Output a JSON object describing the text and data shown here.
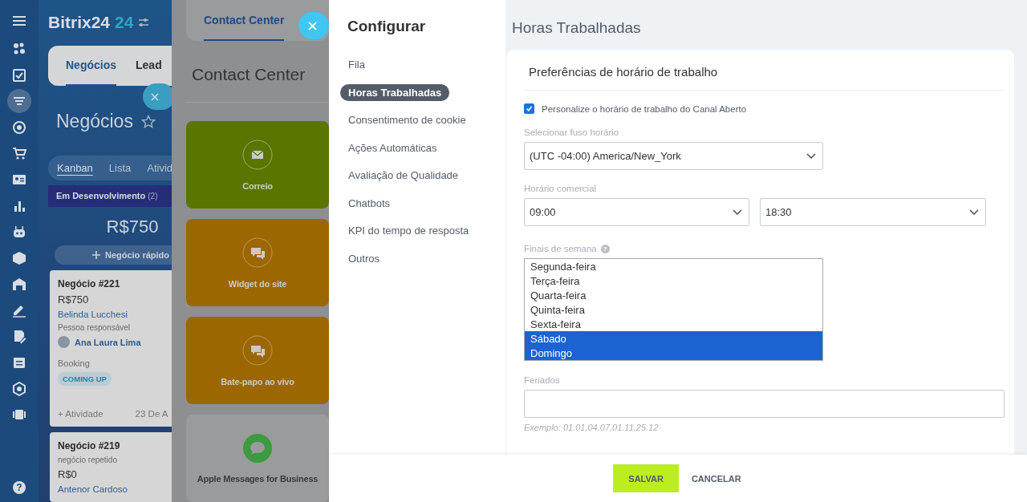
{
  "app": {
    "logo": "Bitrix24",
    "logo_badge": "24",
    "help": "?",
    "nav": [
      {
        "selected": false
      },
      {
        "selected": false
      },
      {
        "selected": true
      },
      {
        "selected": false
      },
      {
        "selected": false
      },
      {
        "selected": false
      },
      {
        "selected": false
      },
      {
        "selected": false
      },
      {
        "selected": false
      },
      {
        "selected": false
      },
      {
        "selected": false
      },
      {
        "selected": false
      },
      {
        "selected": false
      },
      {
        "selected": false
      },
      {
        "selected": false
      }
    ],
    "tabs": [
      {
        "label": "Negócios",
        "selected": true
      },
      {
        "label": "Lead",
        "selected": false
      }
    ],
    "title": "Negócios",
    "views": [
      {
        "label": "Kanban",
        "selected": true
      },
      {
        "label": "Lista",
        "selected": false
      },
      {
        "label": "Ativid",
        "selected": false
      }
    ],
    "column": {
      "title": "Em Desenvolvimento",
      "count": "(2)",
      "total": "R$750",
      "quick_add": "Negócio rápido",
      "cards": [
        {
          "title": "Negócio #221",
          "amount": "R$750",
          "contact": "Belinda Lucchesi",
          "responsible_label": "Pessoa responsável",
          "responsible": "Ana Laura Lima",
          "source": "Booking",
          "tag": "COMING UP",
          "activity": "+ Atividade",
          "date": "23 De A"
        },
        {
          "title": "Negócio #219",
          "note": "negócio repetido",
          "amount": "R$0",
          "contact": "Antenor Cardoso"
        }
      ]
    }
  },
  "contact_center": {
    "tab": "Contact Center",
    "title": "Contact Center",
    "tiles": [
      {
        "label": "Correio",
        "kind": "mail",
        "color": "#5a7500"
      },
      {
        "label": "Widget do site",
        "kind": "chat",
        "color": "#9c6700"
      },
      {
        "label": "Bate-papo ao vivo",
        "kind": "chat",
        "color": "#9c6700"
      },
      {
        "label": "Apple Messages for Business",
        "kind": "bubble",
        "color": "#9a9b9c"
      }
    ]
  },
  "settings": {
    "title": "Configurar",
    "menu": [
      {
        "label": "Fila",
        "selected": false
      },
      {
        "label": "Horas Trabalhadas",
        "selected": true
      },
      {
        "label": "Consentimento de cookie",
        "selected": false
      },
      {
        "label": "Ações Automáticas",
        "selected": false
      },
      {
        "label": "Avaliação de Qualidade",
        "selected": false
      },
      {
        "label": "Chatbots",
        "selected": false
      },
      {
        "label": "KPI do tempo de resposta",
        "selected": false
      },
      {
        "label": "Outros",
        "selected": false
      }
    ],
    "page_title": "Horas Trabalhadas",
    "section_title": "Preferências de horário de trabalho",
    "customize": {
      "label": "Personalize o horário de trabalho do Canal Aberto",
      "checked": true
    },
    "timezone": {
      "label": "Selecionar fuso horário",
      "value": "(UTC -04:00) America/New_York"
    },
    "business_hours": {
      "label": "Horário comercial",
      "from": "09:00",
      "to": "18:30"
    },
    "weekends": {
      "label": "Finais de semana",
      "help": "?",
      "options": [
        {
          "label": "Segunda-feira",
          "selected": false
        },
        {
          "label": "Terça-feira",
          "selected": false
        },
        {
          "label": "Quarta-feira",
          "selected": false
        },
        {
          "label": "Quinta-feira",
          "selected": false
        },
        {
          "label": "Sexta-feira",
          "selected": false
        },
        {
          "label": "Sábado",
          "selected": true
        },
        {
          "label": "Domingo",
          "selected": true
        }
      ]
    },
    "holidays": {
      "label": "Feriados",
      "hint": "Exemplo: 01.01,04.07,01.11,25.12"
    },
    "buttons": [
      {
        "label": "SALVAR",
        "kind": "primary"
      },
      {
        "label": "CANCELAR",
        "kind": "link"
      }
    ]
  }
}
